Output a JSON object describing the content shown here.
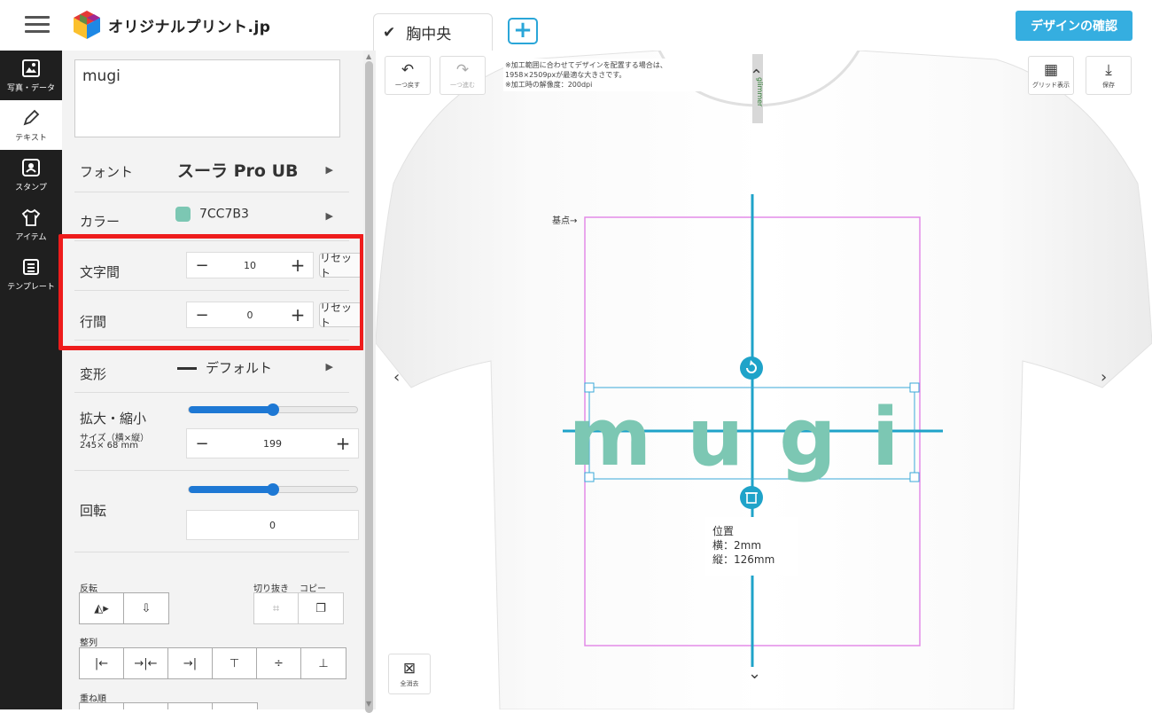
{
  "app": {
    "logo_text": "オリジナルプリント.jp",
    "design_tab": "胸中央",
    "add_tab": "+",
    "confirm_button": "デザインの確認"
  },
  "sidebar": {
    "items": [
      {
        "label": "写真・データ",
        "icon": "image-icon",
        "glyph": "🖼"
      },
      {
        "label": "テキスト",
        "icon": "pencil-icon",
        "glyph": "✎",
        "active": true
      },
      {
        "label": "スタンプ",
        "icon": "stamp-icon",
        "glyph": "✿"
      },
      {
        "label": "アイテム",
        "icon": "tshirt-icon",
        "glyph": "👕"
      },
      {
        "label": "テンプレート",
        "icon": "template-icon",
        "glyph": "▤"
      }
    ]
  },
  "panel": {
    "text_value": "mugi",
    "font": {
      "label": "フォント",
      "value": "スーラ Pro UB"
    },
    "color": {
      "label": "カラー",
      "value": "7CC7B3",
      "hex": "#7CC7B3"
    },
    "letter_spacing": {
      "label": "文字間",
      "value": "10",
      "reset": "リセット"
    },
    "line_spacing": {
      "label": "行間",
      "value": "0",
      "reset": "リセット"
    },
    "transform": {
      "label": "変形",
      "value": "デフォルト"
    },
    "scale": {
      "label": "拡大・縮小",
      "size_label": "サイズ（横×縦）",
      "size_value": "245× 68 mm",
      "value": "199",
      "slider_fraction": 0.5
    },
    "rotation": {
      "label": "回転",
      "value": "0",
      "slider_fraction": 0.5
    },
    "flip_label": "反転",
    "crop_label": "切り抜き",
    "copy_label": "コピー",
    "align_label": "整列",
    "order_label": "重ね順",
    "minus": "−",
    "plus": "+"
  },
  "canvas": {
    "undo_label": "一つ戻す",
    "redo_label": "一つ進む",
    "notice": [
      "※加工範囲に合わせてデザインを配置する場合は、",
      "1958×2509pxが最適な大きさです。",
      "※加工時の解像度：200dpi"
    ],
    "grid_label": "グリッド表示",
    "save_label": "保存",
    "clear_all_label": "全消去",
    "origin_label": "基点→",
    "design_text": "mugi",
    "tag_text": "glimmer",
    "position": {
      "title": "位置",
      "x": "横：2mm",
      "y": "縦：126mm"
    }
  }
}
